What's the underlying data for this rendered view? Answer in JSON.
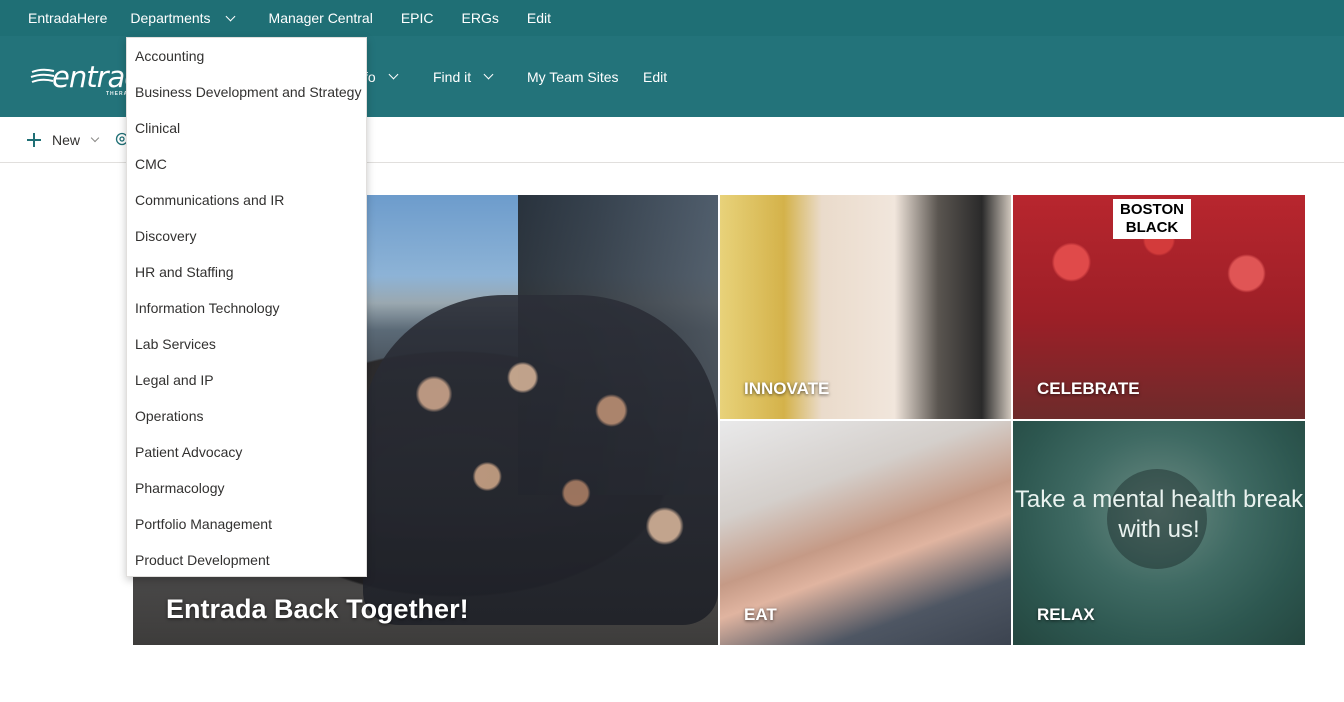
{
  "topbar": {
    "items": [
      {
        "label": "EntradaHere"
      },
      {
        "label": "Departments"
      },
      {
        "label": "Manager Central"
      },
      {
        "label": "EPIC"
      },
      {
        "label": "ERGs"
      },
      {
        "label": "Edit"
      }
    ]
  },
  "site_header": {
    "logo_text": "entrada",
    "logo_sub": "THERAPEUTICS",
    "nav": [
      {
        "label": "fo"
      },
      {
        "label": "Find it"
      },
      {
        "label": "My Team Sites"
      },
      {
        "label": "Edit"
      }
    ]
  },
  "command_bar": {
    "new_label": "New"
  },
  "departments_menu": {
    "items": [
      "Accounting",
      "Business Development and Strategy",
      "Clinical",
      "CMC",
      "Communications and IR",
      "Discovery",
      "HR and Staffing",
      "Information Technology",
      "Lab Services",
      "Legal and IP",
      "Operations",
      "Patient Advocacy",
      "Pharmacology",
      "Portfolio Management",
      "Product Development"
    ]
  },
  "hero": {
    "main_caption": "Entrada Back Together!",
    "tiles": [
      {
        "caption": "INNOVATE"
      },
      {
        "caption": "CELEBRATE"
      },
      {
        "caption": "EAT"
      },
      {
        "caption": "RELAX"
      }
    ],
    "celebrate_sign": "BOSTON BLACK",
    "relax_message": "Take a mental health break with us!"
  },
  "colors": {
    "topbar_bg": "#1f6f75",
    "header_bg": "#23737a",
    "accent": "#1f6f75"
  }
}
